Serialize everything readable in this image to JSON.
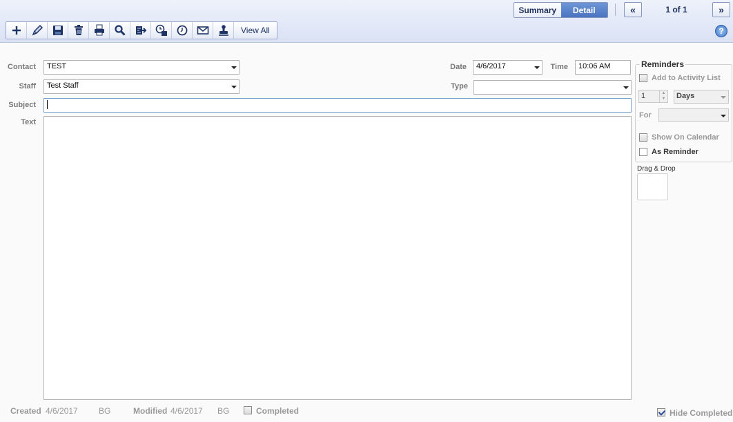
{
  "header": {
    "view_toggle": {
      "summary": "Summary",
      "detail": "Detail"
    },
    "prev": "«",
    "next": "»",
    "pager": "1 of 1"
  },
  "toolbar": {
    "icons": [
      "add-icon",
      "edit-icon",
      "save-icon",
      "delete-icon",
      "print-icon",
      "search-icon",
      "export-icon",
      "schedule-icon",
      "clock-icon",
      "email-icon",
      "stamp-icon"
    ],
    "view_all": "View All",
    "help": "?"
  },
  "form": {
    "contact_label": "Contact",
    "contact_value": "TEST",
    "staff_label": "Staff",
    "staff_value": "Test Staff",
    "subject_label": "Subject",
    "subject_value": "",
    "text_label": "Text",
    "date_label": "Date",
    "date_value": "4/6/2017",
    "time_label": "Time",
    "time_value": "10:06 AM",
    "type_label": "Type",
    "type_value": ""
  },
  "reminders": {
    "title": "Reminders",
    "add_to_activity": "Add to Activity List",
    "add_to_activity_checked": false,
    "count": "1",
    "unit": "Days",
    "for_label": "For",
    "for_value": "",
    "show_on_calendar": "Show On Calendar",
    "show_on_calendar_checked": false,
    "as_reminder": "As Reminder",
    "as_reminder_checked": false,
    "drag_drop": "Drag & Drop"
  },
  "footer": {
    "created_label": "Created",
    "created_date": "4/6/2017",
    "created_by": "BG",
    "modified_label": "Modified",
    "modified_date": "4/6/2017",
    "modified_by": "BG",
    "completed_label": "Completed",
    "completed_checked": false,
    "hide_completed_label": "Hide Completed",
    "hide_completed_checked": true
  }
}
